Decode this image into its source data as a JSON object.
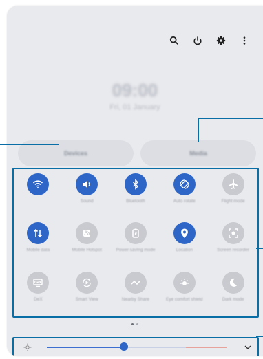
{
  "top_icons": [
    "search-icon",
    "power-icon",
    "settings-icon",
    "more-vert-icon"
  ],
  "clock": {
    "time": "09:00",
    "date": "Fri, 01 January"
  },
  "buttons": {
    "devices": "Devices",
    "media": "Media"
  },
  "tiles": [
    {
      "name": "wifi",
      "label": "",
      "state": "on"
    },
    {
      "name": "sound",
      "label": "Sound",
      "state": "on"
    },
    {
      "name": "bluetooth",
      "label": "Bluetooth",
      "state": "on"
    },
    {
      "name": "auto-rotate",
      "label": "Auto rotate",
      "state": "on"
    },
    {
      "name": "flight-mode",
      "label": "Flight mode",
      "state": "off"
    },
    {
      "name": "mobile-data",
      "label": "Mobile data",
      "state": "on"
    },
    {
      "name": "mobile-hotspot",
      "label": "Mobile Hotspot",
      "state": "off"
    },
    {
      "name": "power-saving",
      "label": "Power saving mode",
      "state": "off"
    },
    {
      "name": "location",
      "label": "Location",
      "state": "on"
    },
    {
      "name": "screen-recorder",
      "label": "Screen recorder",
      "state": "off"
    },
    {
      "name": "dex",
      "label": "DeX",
      "state": "off"
    },
    {
      "name": "smart-view",
      "label": "Smart View",
      "state": "off"
    },
    {
      "name": "nearby-share",
      "label": "Nearby Share",
      "state": "off"
    },
    {
      "name": "eye-comfort",
      "label": "Eye comfort shield",
      "state": "off"
    },
    {
      "name": "dark-mode",
      "label": "Dark mode",
      "state": "off"
    }
  ],
  "page_indicator": {
    "current": 1,
    "total": 2
  },
  "brightness": {
    "level": 0.38,
    "icon": "sun-icon",
    "expand_icon": "chevron-down-icon"
  },
  "colors": {
    "accent": "#2e66c7",
    "callout": "#0a6ea6",
    "panel": "#e9eaee"
  }
}
